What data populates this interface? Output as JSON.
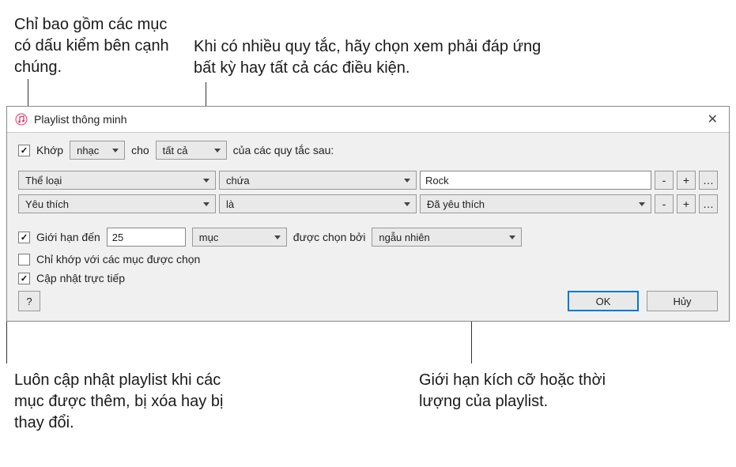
{
  "annotations": {
    "top_left": "Chỉ bao gồm các mục có dấu kiểm bên cạnh chúng.",
    "top_right": "Khi có nhiều quy tắc, hãy chọn xem phải đáp ứng bất kỳ hay tất cả các điều kiện.",
    "bottom_left": "Luôn cập nhật playlist khi các mục được thêm, bị xóa hay bị thay đổi.",
    "bottom_right": "Giới hạn kích cỡ hoặc thời lượng của playlist."
  },
  "dialog": {
    "title": "Playlist thông minh",
    "match": {
      "check_label": "Khớp",
      "type": "nhạc",
      "for_label": "cho",
      "scope": "tất cả",
      "suffix": "của các quy tắc sau:"
    },
    "rules": [
      {
        "field": "Thể loại",
        "op": "chứa",
        "value_type": "text",
        "value": "Rock"
      },
      {
        "field": "Yêu thích",
        "op": "là",
        "value_type": "select",
        "value": "Đã yêu thích"
      }
    ],
    "limit": {
      "label": "Giới hạn đến",
      "value": "25",
      "unit": "mục",
      "selected_by_label": "được chọn bởi",
      "selected_by": "ngẫu nhiên"
    },
    "match_checked_label": "Chỉ khớp với các mục được chọn",
    "live_update_label": "Cập nhật trực tiếp",
    "help": "?",
    "ok": "OK",
    "cancel": "Hủy"
  }
}
